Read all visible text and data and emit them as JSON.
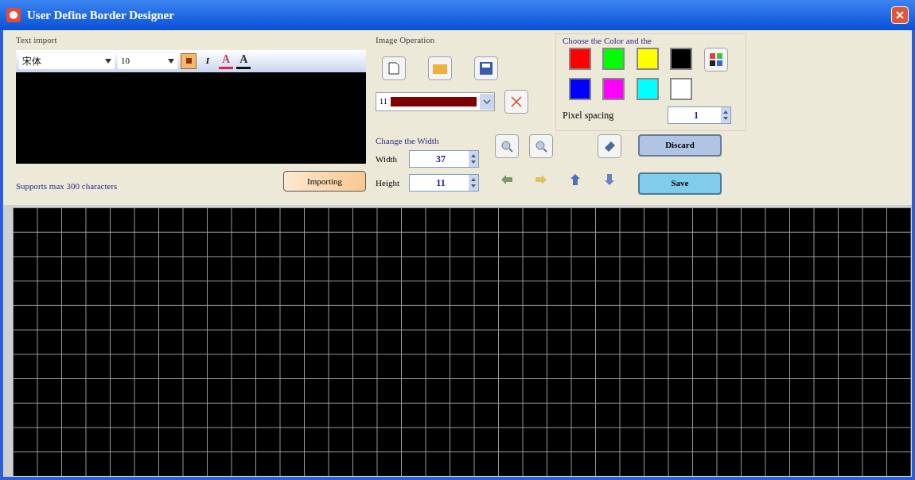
{
  "window": {
    "title": "User Define Border Designer"
  },
  "text_import": {
    "title": "Text import",
    "font": "宋体",
    "size": "10",
    "format_buttons": [
      {
        "kind": "bold",
        "selected": true
      },
      {
        "kind": "italic",
        "label": "I",
        "selected": false
      }
    ],
    "color_buttons": [
      {
        "kind": "font",
        "label": "A"
      },
      {
        "kind": "background",
        "label": "A"
      }
    ],
    "hint": "Supports max 300 characters",
    "import_button": "Importing"
  },
  "image_operation": {
    "title": "Image Operation",
    "border_select": {
      "value": "11"
    }
  },
  "size": {
    "title": "Change the Width",
    "width": {
      "label": "Width",
      "value": "37"
    },
    "height": {
      "label": "Height",
      "value": "11"
    }
  },
  "actions": {
    "discard": "Discard",
    "save": "Save"
  },
  "colors": {
    "title": "Choose the Color and the",
    "swatches": [
      {
        "color": "#ff0000"
      },
      {
        "color": "#00ff00"
      },
      {
        "color": "#ffff00"
      },
      {
        "color": "#000000"
      },
      {
        "color": "#0000ff"
      },
      {
        "color": "#ff00ff"
      },
      {
        "color": "#00ffff"
      },
      {
        "color": "#ffffff"
      }
    ],
    "spacing": {
      "label": "Pixel spacing",
      "value": "1"
    }
  }
}
